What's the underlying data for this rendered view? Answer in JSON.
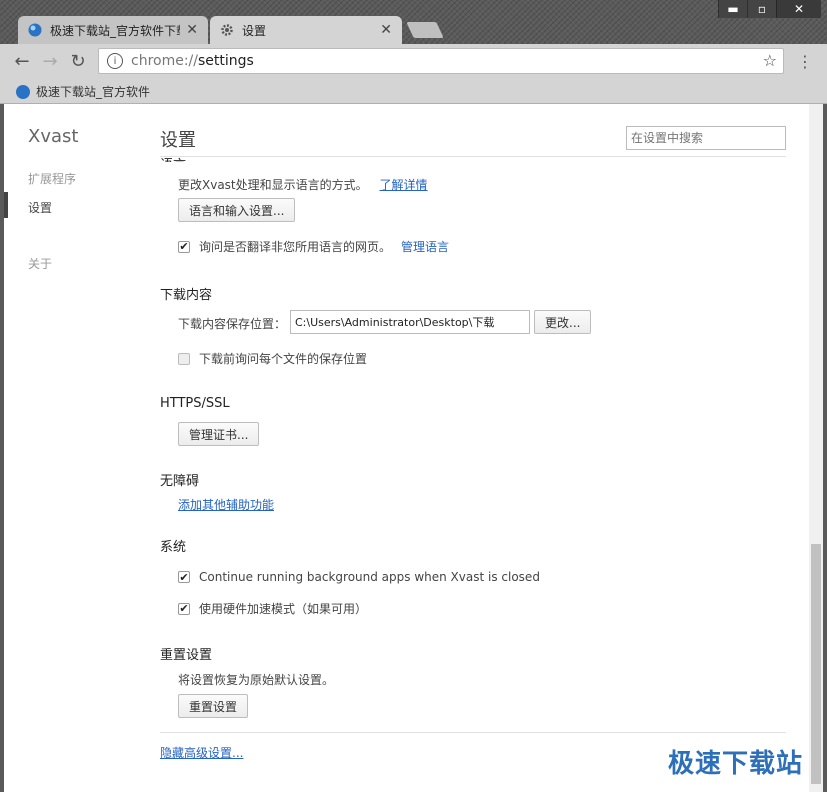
{
  "window": {
    "minimize_glyph": "▬",
    "maximize_glyph": "▫",
    "close_glyph": "✕"
  },
  "tabs": [
    {
      "title": "极速下载站_官方软件下载",
      "close": "✕"
    },
    {
      "title": "设置",
      "close": "✕"
    }
  ],
  "toolbar": {
    "back": "←",
    "forward": "→",
    "reload": "↻",
    "info": "i",
    "url_scheme": "chrome://",
    "url_path": "settings",
    "star": "☆",
    "menu": "⋮"
  },
  "bookmarks": [
    {
      "label": "极速下载站_官方软件"
    }
  ],
  "sidebar": {
    "brand": "Xvast",
    "items": [
      {
        "label": "扩展程序"
      },
      {
        "label": "设置"
      },
      {
        "label": "关于"
      }
    ]
  },
  "header": {
    "title": "设置",
    "search_placeholder": "在设置中搜索"
  },
  "language": {
    "heading_clipped": "语言",
    "description": "更改Xvast处理和显示语言的方式。",
    "learn_more": "了解详情",
    "settings_button": "语言和输入设置...",
    "translate_label": "询问是否翻译非您所用语言的网页。",
    "manage_languages": "管理语言"
  },
  "downloads": {
    "title": "下载内容",
    "location_label": "下载内容保存位置：",
    "location_value": "C:\\Users\\Administrator\\Desktop\\下载",
    "change_button": "更改...",
    "ask_label": "下载前询问每个文件的保存位置"
  },
  "https": {
    "title": "HTTPS/SSL",
    "manage_certs": "管理证书..."
  },
  "accessibility": {
    "title": "无障碍",
    "add_features": "添加其他辅助功能"
  },
  "system": {
    "title": "系统",
    "background_apps": "Continue running background apps when Xvast is closed",
    "hardware_accel": "使用硬件加速模式（如果可用）"
  },
  "reset": {
    "title": "重置设置",
    "description": "将设置恢复为原始默认设置。",
    "button": "重置设置"
  },
  "footer": {
    "hide_advanced": "隐藏高级设置..."
  },
  "watermark": "极速下载站",
  "checkmark": "✔",
  "colors": {
    "link": "#2563c4",
    "watermark": "#2d6fb8"
  }
}
